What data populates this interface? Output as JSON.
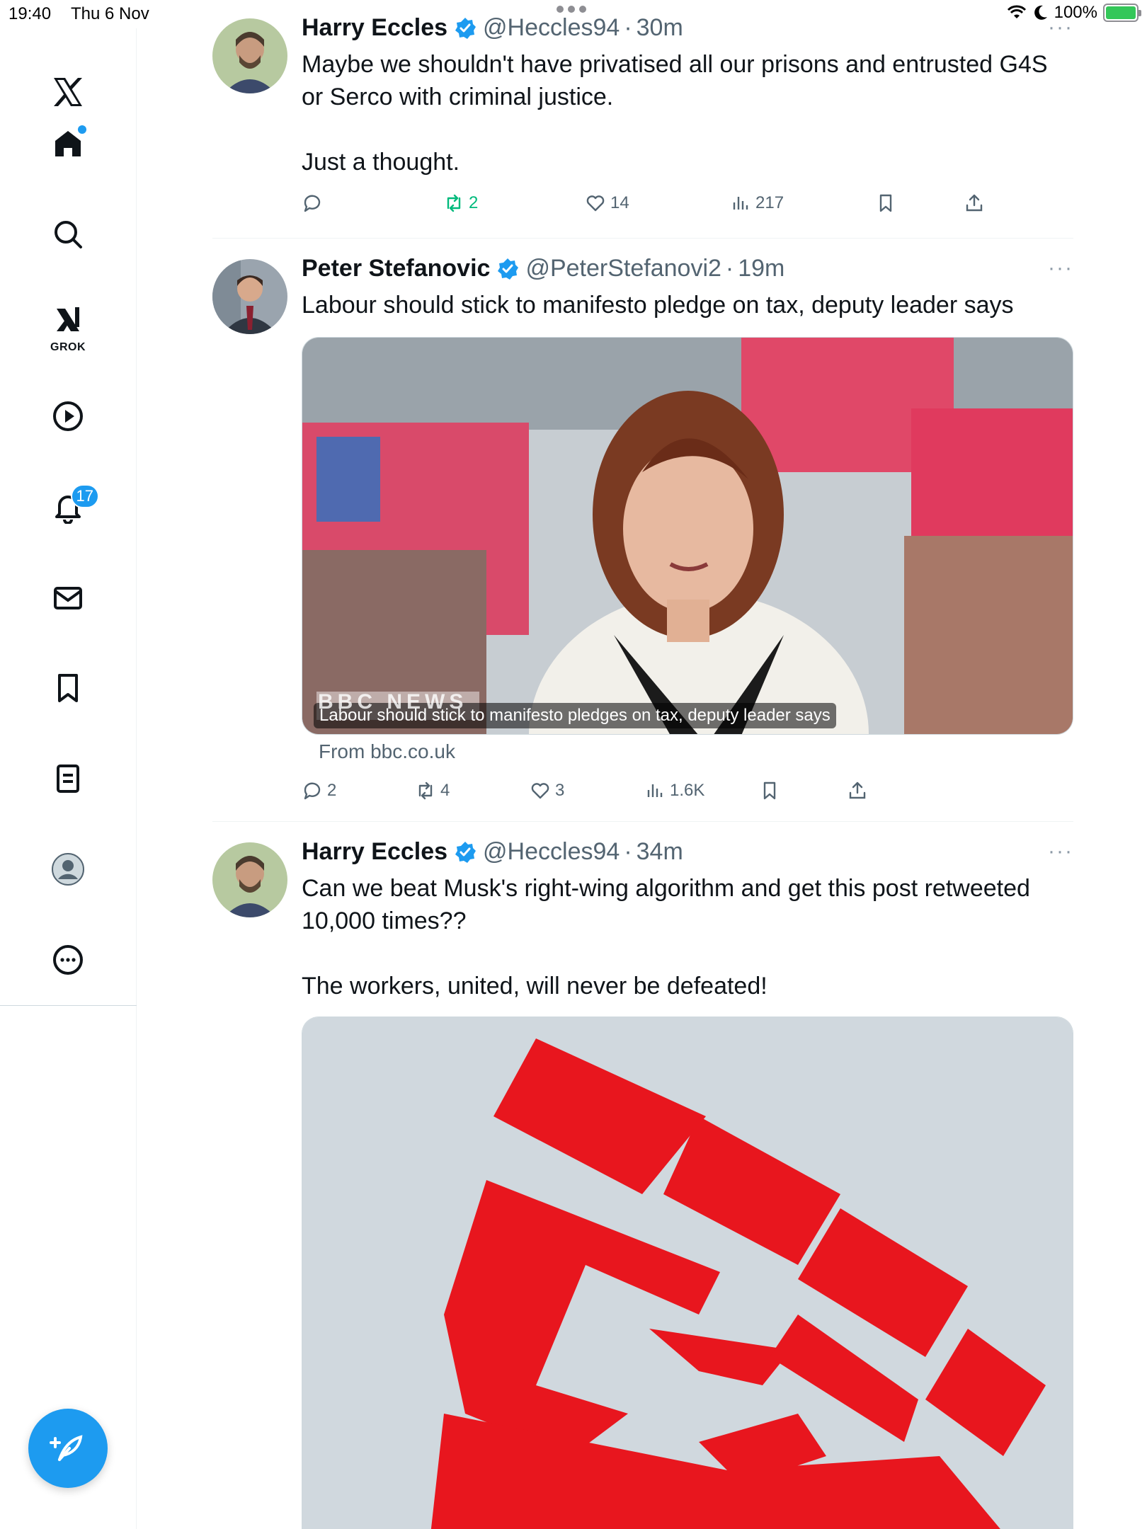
{
  "status_bar": {
    "time": "19:40",
    "date": "Thu 6 Nov",
    "battery": "100%",
    "battery_color": "#34c759"
  },
  "sidebar": {
    "badge_color": "#1d9bf0",
    "items": [
      {
        "name": "x-logo",
        "icon": "x-logo-icon"
      },
      {
        "name": "home",
        "icon": "home-icon",
        "has_dot": true
      },
      {
        "name": "search",
        "icon": "search-icon"
      },
      {
        "name": "grok",
        "icon": "grok-icon",
        "label": "GROK"
      },
      {
        "name": "videos",
        "icon": "play-icon"
      },
      {
        "name": "notifications",
        "icon": "bell-icon",
        "badge": "17"
      },
      {
        "name": "messages",
        "icon": "envelope-icon"
      },
      {
        "name": "bookmarks",
        "icon": "bookmark-icon"
      },
      {
        "name": "lists",
        "icon": "list-icon"
      },
      {
        "name": "profile",
        "icon": "profile-icon"
      },
      {
        "name": "more",
        "icon": "more-circle-icon"
      }
    ],
    "compose_icon": "compose-feather-icon"
  },
  "feed": {
    "accent": "#1d9bf0",
    "tweets": [
      {
        "author": "Harry Eccles",
        "handle": "@Heccles94",
        "separator": "·",
        "time": "30m",
        "text": "Maybe we shouldn't have privatised all our prisons and entrusted G4S or Serco with criminal justice.\n\nJust a thought.",
        "actions": {
          "replies": "",
          "retweets": "2",
          "likes": "14",
          "views": "217"
        },
        "retweeted_color": "#00ba7c"
      },
      {
        "author": "Peter Stefanovic",
        "handle": "@PeterStefanovi2",
        "separator": "·",
        "time": "19m",
        "text": "Labour should stick to manifesto pledge on tax, deputy leader says",
        "card": {
          "logo_text": "BBC NEWS",
          "caption": "Labour should stick to manifesto pledges on tax, deputy leader says",
          "source": "From bbc.co.uk"
        },
        "actions": {
          "replies": "2",
          "retweets": "4",
          "likes": "3",
          "views": "1.6K"
        }
      },
      {
        "author": "Harry Eccles",
        "handle": "@Heccles94",
        "separator": "·",
        "time": "34m",
        "text": "Can we beat Musk's right-wing algorithm and get this post retweeted 10,000 times??\n\nThe workers, united, will never be defeated!",
        "image": {
          "subject": "red raised fist",
          "fist_color": "#e8161e",
          "background": "#d0d8de"
        }
      }
    ]
  }
}
